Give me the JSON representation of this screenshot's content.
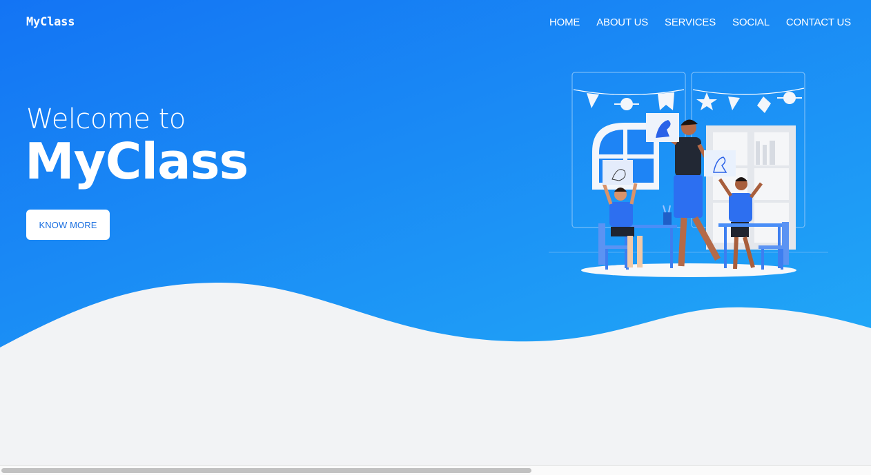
{
  "brand": "MyClass",
  "nav": {
    "items": [
      "HOME",
      "ABOUT US",
      "SERVICES",
      "SOCIAL",
      "CONTACT US"
    ]
  },
  "hero": {
    "line1": "Welcome to",
    "line2": "MyClass",
    "button_label": "KNOW MORE"
  },
  "colors": {
    "primary": "#1374f4",
    "accent": "#21a8f7",
    "background": "#f2f3f5",
    "button_text": "#1a6fe0"
  },
  "illustration": {
    "icon": "classroom-illustration-icon"
  }
}
